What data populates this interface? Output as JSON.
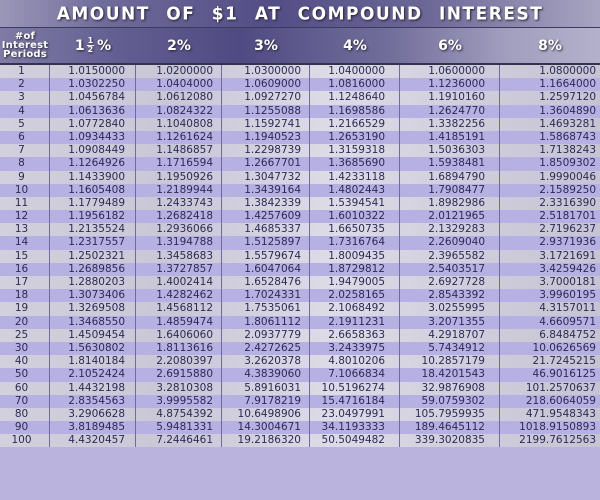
{
  "title": "AMOUNT OF $1 AT COMPOUND INTEREST",
  "header": {
    "periods_lines": [
      "#of",
      "Interest",
      "Periods"
    ],
    "rates": [
      {
        "whole": "1",
        "num": "1",
        "den": "2",
        "suffix": "%"
      },
      {
        "label": "2%"
      },
      {
        "label": "3%"
      },
      {
        "label": "4%"
      },
      {
        "label": "6%"
      },
      {
        "label": "8%"
      }
    ]
  },
  "colors": {
    "row_light": "#d2d0dc",
    "row_purple": "#b7b0e3",
    "text": "#2d2a55",
    "header_dark": "#4f4b82"
  },
  "rows": [
    [
      "1",
      "1.0150000",
      "1.0200000",
      "1.0300000",
      "1.0400000",
      "1.0600000",
      "1.0800000"
    ],
    [
      "2",
      "1.0302250",
      "1.0404000",
      "1.0609000",
      "1.0816000",
      "1.1236000",
      "1.1664000"
    ],
    [
      "3",
      "1.0456784",
      "1.0612080",
      "1.0927270",
      "1.1248640",
      "1.1910160",
      "1.2597120"
    ],
    [
      "4",
      "1.0613636",
      "1.0824322",
      "1.1255088",
      "1.1698586",
      "1.2624770",
      "1.3604890"
    ],
    [
      "5",
      "1.0772840",
      "1.1040808",
      "1.1592741",
      "1.2166529",
      "1.3382256",
      "1.4693281"
    ],
    [
      "6",
      "1.0934433",
      "1.1261624",
      "1.1940523",
      "1.2653190",
      "1.4185191",
      "1.5868743"
    ],
    [
      "7",
      "1.0908449",
      "1.1486857",
      "1.2298739",
      "1.3159318",
      "1.5036303",
      "1.7138243"
    ],
    [
      "8",
      "1.1264926",
      "1.1716594",
      "1.2667701",
      "1.3685690",
      "1.5938481",
      "1.8509302"
    ],
    [
      "9",
      "1.1433900",
      "1.1950926",
      "1.3047732",
      "1.4233118",
      "1.6894790",
      "1.9990046"
    ],
    [
      "10",
      "1.1605408",
      "1.2189944",
      "1.3439164",
      "1.4802443",
      "1.7908477",
      "2.1589250"
    ],
    [
      "11",
      "1.1779489",
      "1.2433743",
      "1.3842339",
      "1.5394541",
      "1.8982986",
      "2.3316390"
    ],
    [
      "12",
      "1.1956182",
      "1.2682418",
      "1.4257609",
      "1.6010322",
      "2.0121965",
      "2.5181701"
    ],
    [
      "13",
      "1.2135524",
      "1.2936066",
      "1.4685337",
      "1.6650735",
      "2.1329283",
      "2.7196237"
    ],
    [
      "14",
      "1.2317557",
      "1.3194788",
      "1.5125897",
      "1.7316764",
      "2.2609040",
      "2.9371936"
    ],
    [
      "15",
      "1.2502321",
      "1.3458683",
      "1.5579674",
      "1.8009435",
      "2.3965582",
      "3.1721691"
    ],
    [
      "16",
      "1.2689856",
      "1.3727857",
      "1.6047064",
      "1.8729812",
      "2.5403517",
      "3.4259426"
    ],
    [
      "17",
      "1.2880203",
      "1.4002414",
      "1.6528476",
      "1.9479005",
      "2.6927728",
      "3.7000181"
    ],
    [
      "18",
      "1.3073406",
      "1.4282462",
      "1.7024331",
      "2.0258165",
      "2.8543392",
      "3.9960195"
    ],
    [
      "19",
      "1.3269508",
      "1.4568112",
      "1.7535061",
      "2.1068492",
      "3.0255995",
      "4.3157011"
    ],
    [
      "20",
      "1.3468550",
      "1.4859474",
      "1.8061112",
      "2.1911231",
      "3.2071355",
      "4.6609571"
    ],
    [
      "25",
      "1.4509454",
      "1.6406060",
      "2.0937779",
      "2.6658363",
      "4.2918707",
      "6.8484752"
    ],
    [
      "30",
      "1.5630802",
      "1.8113616",
      "2.4272625",
      "3.2433975",
      "5.7434912",
      "10.0626569"
    ],
    [
      "40",
      "1.8140184",
      "2.2080397",
      "3.2620378",
      "4.8010206",
      "10.2857179",
      "21.7245215"
    ],
    [
      "50",
      "2.1052424",
      "2.6915880",
      "4.3839060",
      "7.1066834",
      "18.4201543",
      "46.9016125"
    ],
    [
      "60",
      "1.4432198",
      "3.2810308",
      "5.8916031",
      "10.5196274",
      "32.9876908",
      "101.2570637"
    ],
    [
      "70",
      "2.8354563",
      "3.9995582",
      "7.9178219",
      "15.4716184",
      "59.0759302",
      "218.6064059"
    ],
    [
      "80",
      "3.2906628",
      "4.8754392",
      "10.6498906",
      "23.0497991",
      "105.7959935",
      "471.9548343"
    ],
    [
      "90",
      "3.8189485",
      "5.9481331",
      "14.3004671",
      "34.1193333",
      "189.4645112",
      "1018.9150893"
    ],
    [
      "100",
      "4.4320457",
      "7.2446461",
      "19.2186320",
      "50.5049482",
      "339.3020835",
      "2199.7612563"
    ]
  ]
}
